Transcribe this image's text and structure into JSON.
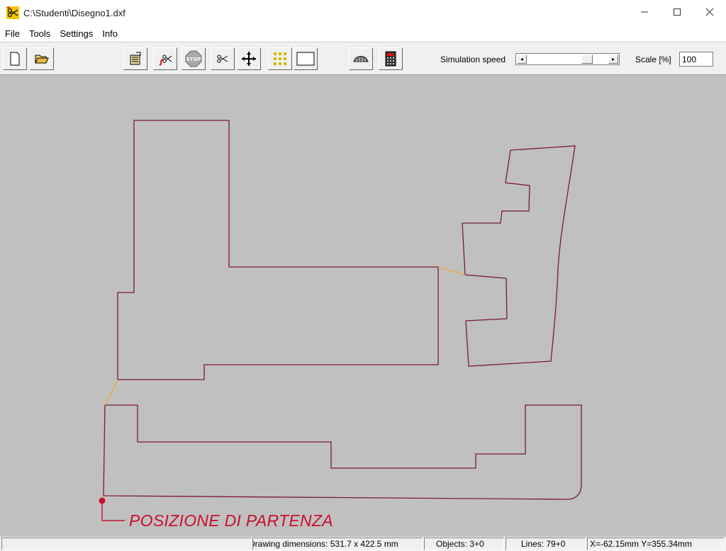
{
  "window": {
    "title": "C:\\Studenti\\Disegno1.dxf",
    "minimize": "—",
    "maximize": "☐",
    "close": "✕"
  },
  "menu": [
    "File",
    "Tools",
    "Settings",
    "Info"
  ],
  "toolbar": {
    "buttons": [
      {
        "name": "new-file-button",
        "icon": "blank-page-icon"
      },
      {
        "name": "open-file-button",
        "icon": "folder-open-icon"
      },
      {
        "name": "export-button",
        "icon": "document-export-icon"
      },
      {
        "name": "cut-path-button",
        "icon": "scissors-path-icon"
      },
      {
        "name": "stop-button",
        "icon": "stop-sign-icon"
      },
      {
        "name": "cut-button",
        "icon": "scissors-icon"
      },
      {
        "name": "move-button",
        "icon": "move-arrows-icon"
      },
      {
        "name": "grid-button",
        "icon": "grid-icon"
      },
      {
        "name": "frame-button",
        "icon": "rectangle-icon"
      },
      {
        "name": "tool-head-button",
        "icon": "cutter-head-icon"
      },
      {
        "name": "calculator-button",
        "icon": "calculator-icon"
      }
    ],
    "simulation_speed_label": "Simulation speed",
    "simulation_speed_level": 0.78,
    "scale_label": "Scale [%]",
    "scale_value": "100"
  },
  "canvas": {
    "background": "#c0c0c0",
    "path_color": "#7a1a3a",
    "transition_color": "#f0a830",
    "start_marker_color": "#c8102e",
    "annotation": "POSIZIONE DI PARTENZA"
  },
  "status": {
    "empty": "",
    "dimensions": "Drawing dimensions: 531.7 x 422.5 mm",
    "objects": "Objects: 3+0",
    "lines": "Lines: 79+0",
    "coords": "X=-62.15mm Y=355.34mm"
  }
}
